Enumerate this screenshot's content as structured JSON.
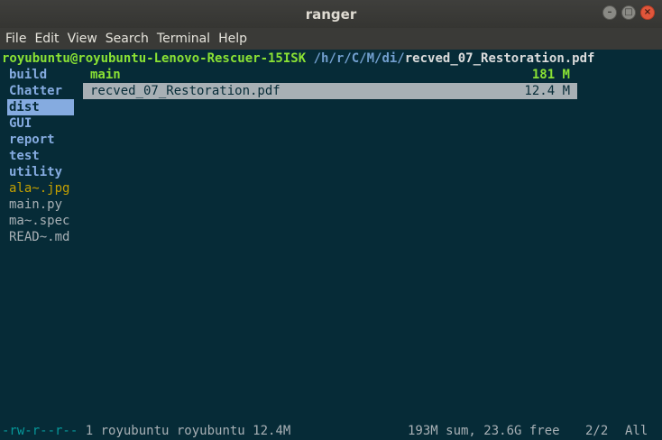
{
  "window": {
    "title": "ranger",
    "buttons": {
      "minimize": "–",
      "maximize": "□",
      "close": "×"
    }
  },
  "menu": [
    "File",
    "Edit",
    "View",
    "Search",
    "Terminal",
    "Help"
  ],
  "header": {
    "user_host": "royubuntu@royubuntu-Lenovo-Rescuer-15ISK",
    "path": "/h/r/C/M/di/",
    "filename": "recved_07_Restoration.pdf"
  },
  "left_pane": [
    {
      "name": "build",
      "type": "dir"
    },
    {
      "name": "Chatter",
      "type": "dir"
    },
    {
      "name": "dist",
      "type": "dir",
      "selected": true
    },
    {
      "name": "GUI",
      "type": "dir"
    },
    {
      "name": "report",
      "type": "dir"
    },
    {
      "name": "test",
      "type": "dir"
    },
    {
      "name": "utility",
      "type": "dir"
    },
    {
      "name": "ala~.jpg",
      "type": "image"
    },
    {
      "name": "main.py",
      "type": "file"
    },
    {
      "name": "ma~.spec",
      "type": "file"
    },
    {
      "name": "READ~.md",
      "type": "file"
    }
  ],
  "main_pane": [
    {
      "name": "main",
      "size": "181 M",
      "type": "dir"
    },
    {
      "name": "recved_07_Restoration.pdf",
      "size": "12.4 M",
      "type": "file",
      "selected": true
    }
  ],
  "statusbar": {
    "permissions": "-rw-r--r--",
    "info": " 1 royubuntu royubuntu 12.4M",
    "summary": "193M sum, 23.6G free",
    "position": "2/2",
    "scroll": "All"
  },
  "colors": {
    "background": "#062b37",
    "dir": "#85abe0",
    "user": "#8ae234",
    "image": "#c4a000"
  }
}
